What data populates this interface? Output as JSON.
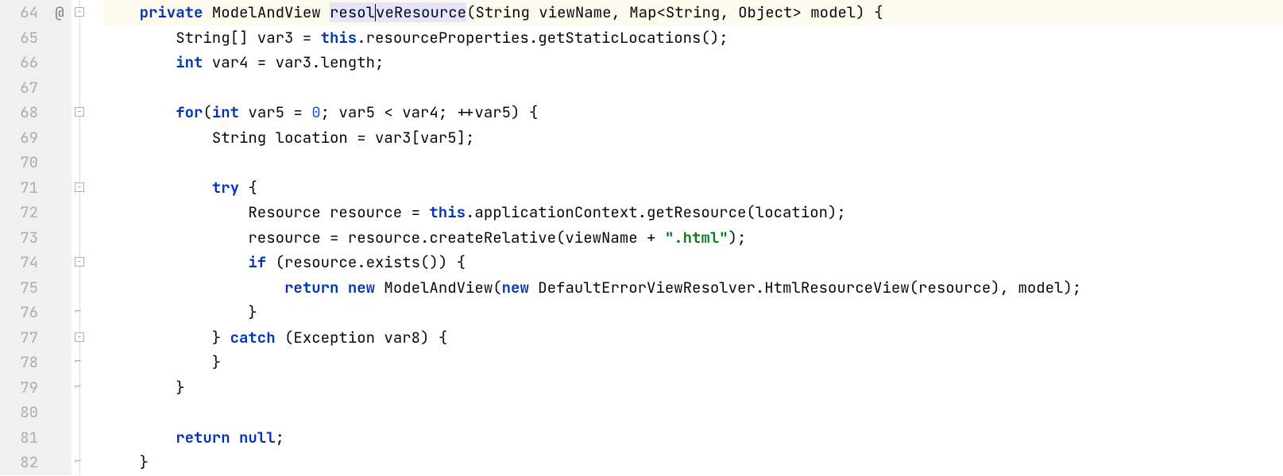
{
  "lines": [
    {
      "num": "64",
      "annot": "@",
      "fold": "open",
      "highlighted": true,
      "tokens": [
        {
          "t": "    ",
          "c": ""
        },
        {
          "t": "private",
          "c": "kw"
        },
        {
          "t": " ModelAndView ",
          "c": ""
        },
        {
          "t": "resol",
          "c": "ident-hl"
        },
        {
          "t": "",
          "c": "caret"
        },
        {
          "t": "veResource",
          "c": "ident-hl"
        },
        {
          "t": "(String viewName, Map<String, Object> model) {",
          "c": ""
        }
      ]
    },
    {
      "num": "65",
      "annot": "",
      "fold": "line",
      "tokens": [
        {
          "t": "        String[] var3 = ",
          "c": ""
        },
        {
          "t": "this",
          "c": "kw"
        },
        {
          "t": ".resourceProperties.getStaticLocations();",
          "c": ""
        }
      ]
    },
    {
      "num": "66",
      "annot": "",
      "fold": "line",
      "tokens": [
        {
          "t": "        ",
          "c": ""
        },
        {
          "t": "int",
          "c": "kw"
        },
        {
          "t": " var4 = var3.length;",
          "c": ""
        }
      ]
    },
    {
      "num": "67",
      "annot": "",
      "fold": "line",
      "tokens": [
        {
          "t": "",
          "c": ""
        }
      ]
    },
    {
      "num": "68",
      "annot": "",
      "fold": "open-line",
      "tokens": [
        {
          "t": "        ",
          "c": ""
        },
        {
          "t": "for",
          "c": "kw"
        },
        {
          "t": "(",
          "c": ""
        },
        {
          "t": "int",
          "c": "kw"
        },
        {
          "t": " var5 = ",
          "c": ""
        },
        {
          "t": "0",
          "c": "num"
        },
        {
          "t": "; var5 < var4; ++var5) {",
          "c": ""
        }
      ]
    },
    {
      "num": "69",
      "annot": "",
      "fold": "line",
      "tokens": [
        {
          "t": "            String location = var3[var5];",
          "c": ""
        }
      ]
    },
    {
      "num": "70",
      "annot": "",
      "fold": "line",
      "tokens": [
        {
          "t": "",
          "c": ""
        }
      ]
    },
    {
      "num": "71",
      "annot": "",
      "fold": "open-line",
      "tokens": [
        {
          "t": "            ",
          "c": ""
        },
        {
          "t": "try",
          "c": "kw"
        },
        {
          "t": " {",
          "c": ""
        }
      ]
    },
    {
      "num": "72",
      "annot": "",
      "fold": "line",
      "tokens": [
        {
          "t": "                Resource resource = ",
          "c": ""
        },
        {
          "t": "this",
          "c": "kw"
        },
        {
          "t": ".applicationContext.getResource(location);",
          "c": ""
        }
      ]
    },
    {
      "num": "73",
      "annot": "",
      "fold": "line",
      "tokens": [
        {
          "t": "                resource = resource.createRelative(viewName + ",
          "c": ""
        },
        {
          "t": "\".html\"",
          "c": "str"
        },
        {
          "t": ");",
          "c": ""
        }
      ]
    },
    {
      "num": "74",
      "annot": "",
      "fold": "open-line",
      "tokens": [
        {
          "t": "                ",
          "c": ""
        },
        {
          "t": "if",
          "c": "kw"
        },
        {
          "t": " (resource.exists()) {",
          "c": ""
        }
      ]
    },
    {
      "num": "75",
      "annot": "",
      "fold": "line",
      "tokens": [
        {
          "t": "                    ",
          "c": ""
        },
        {
          "t": "return new",
          "c": "kw"
        },
        {
          "t": " ModelAndView(",
          "c": ""
        },
        {
          "t": "new",
          "c": "kw"
        },
        {
          "t": " DefaultErrorViewResolver.HtmlResourceView(resource), model);",
          "c": ""
        }
      ]
    },
    {
      "num": "76",
      "annot": "",
      "fold": "close-line",
      "tokens": [
        {
          "t": "                }",
          "c": ""
        }
      ]
    },
    {
      "num": "77",
      "annot": "",
      "fold": "open-line",
      "tokens": [
        {
          "t": "            } ",
          "c": ""
        },
        {
          "t": "catch",
          "c": "kw"
        },
        {
          "t": " (Exception var8) {",
          "c": ""
        }
      ]
    },
    {
      "num": "78",
      "annot": "",
      "fold": "close-line",
      "tokens": [
        {
          "t": "            }",
          "c": ""
        }
      ]
    },
    {
      "num": "79",
      "annot": "",
      "fold": "close-line",
      "tokens": [
        {
          "t": "        }",
          "c": ""
        }
      ]
    },
    {
      "num": "80",
      "annot": "",
      "fold": "line",
      "tokens": [
        {
          "t": "",
          "c": ""
        }
      ]
    },
    {
      "num": "81",
      "annot": "",
      "fold": "line",
      "tokens": [
        {
          "t": "        ",
          "c": ""
        },
        {
          "t": "return null",
          "c": "kw"
        },
        {
          "t": ";",
          "c": ""
        }
      ]
    },
    {
      "num": "82",
      "annot": "",
      "fold": "close",
      "tokens": [
        {
          "t": "    }",
          "c": ""
        }
      ]
    }
  ]
}
